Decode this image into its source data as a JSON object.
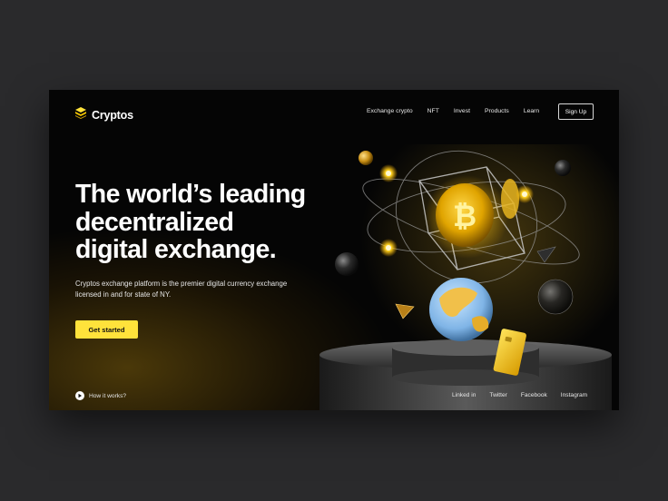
{
  "brand": {
    "name": "Cryptos"
  },
  "nav": {
    "items": [
      "Exchange crypto",
      "NFT",
      "Invest",
      "Products",
      "Learn"
    ],
    "signup_label": "Sign Up"
  },
  "hero": {
    "headline": [
      "The world’s leading",
      "decentralized",
      "digital exchange."
    ],
    "subtext": "Cryptos exchange platform is the premier digital currency exchange licensed in and for state of NY.",
    "cta_label": "Get started"
  },
  "footer": {
    "how_label": "How it works?",
    "social": [
      "Linked in",
      "Twitter",
      "Facebook",
      "Instagram"
    ]
  },
  "colors": {
    "accent": "#ffe23b",
    "background": "#050505",
    "page": "#2a2a2c"
  }
}
